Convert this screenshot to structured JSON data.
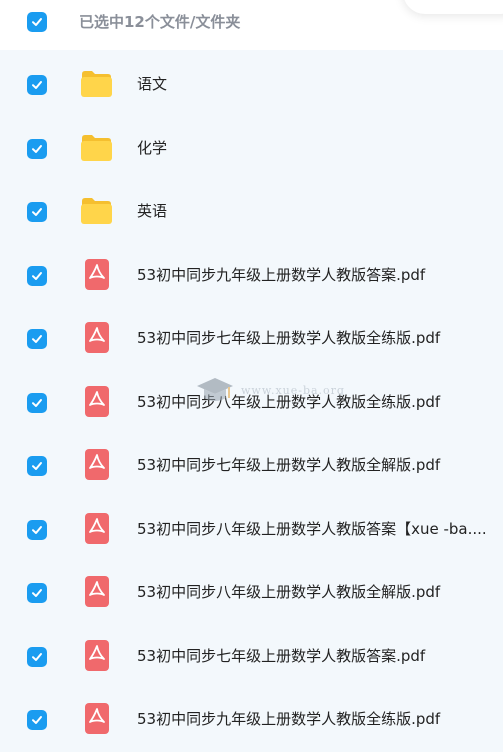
{
  "header": {
    "title": "已选中12个文件/文件夹",
    "select_all_checked": true
  },
  "colors": {
    "checkbox": "#1a9cf0",
    "folder": "#ffd54a",
    "pdf": "#f0696c",
    "background": "#f3f8fc"
  },
  "files": [
    {
      "name": "语文",
      "type": "folder-icon"
    },
    {
      "name": "化学",
      "type": "folder-icon"
    },
    {
      "name": "英语",
      "type": "folder-icon"
    },
    {
      "name": "53初中同步九年级上册数学人教版答案.pdf",
      "type": "pdf-icon"
    },
    {
      "name": "53初中同步七年级上册数学人教版全练版.pdf",
      "type": "pdf-icon"
    },
    {
      "name": "53初中同步八年级上册数学人教版全练版.pdf",
      "type": "pdf-icon"
    },
    {
      "name": "53初中同步七年级上册数学人教版全解版.pdf",
      "type": "pdf-icon"
    },
    {
      "name": "53初中同步八年级上册数学人教版答案【xue -ba....",
      "type": "pdf-icon"
    },
    {
      "name": "53初中同步八年级上册数学人教版全解版.pdf",
      "type": "pdf-icon"
    },
    {
      "name": "53初中同步七年级上册数学人教版答案.pdf",
      "type": "pdf-icon"
    },
    {
      "name": "53初中同步九年级上册数学人教版全练版.pdf",
      "type": "pdf-icon"
    }
  ],
  "watermark": {
    "text": "www.xue-ba.org"
  }
}
